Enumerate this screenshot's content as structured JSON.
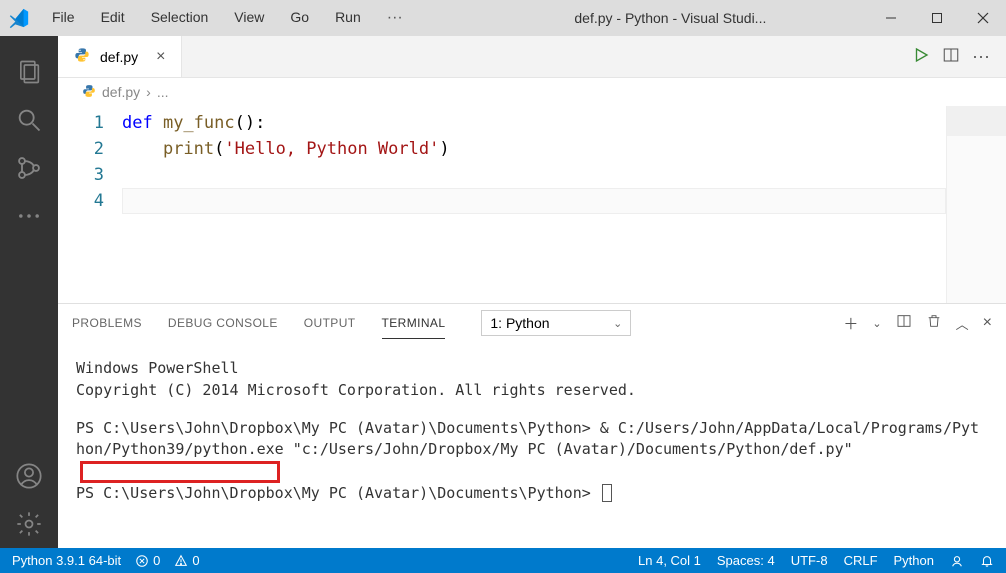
{
  "menu": {
    "file": "File",
    "edit": "Edit",
    "selection": "Selection",
    "view": "View",
    "go": "Go",
    "run": "Run"
  },
  "window_title": "def.py - Python - Visual Studi...",
  "tab": {
    "label": "def.py"
  },
  "breadcrumb": {
    "file": "def.py",
    "sep": "›",
    "rest": "..."
  },
  "code": {
    "line1_kw": "def",
    "line1_fn": " my_func",
    "line1_rest": "():",
    "line2_fn": "print",
    "line2_paren": "(",
    "line2_str": "'Hello, Python World'",
    "line2_close": ")"
  },
  "gutter": {
    "l1": "1",
    "l2": "2",
    "l3": "3",
    "l4": "4"
  },
  "panel": {
    "problems": "PROBLEMS",
    "debug": "DEBUG CONSOLE",
    "output": "OUTPUT",
    "terminal": "TERMINAL",
    "select": "1: Python"
  },
  "terminal": {
    "t1": "Windows PowerShell",
    "t2": "Copyright (C) 2014 Microsoft Corporation. All rights reserved.",
    "t3": "PS C:\\Users\\John\\Dropbox\\My PC (Avatar)\\Documents\\Python> & C:/Users/John/AppData/Local/Programs/Python/Python39/python.exe \"c:/Users/John/Dropbox/My PC (Avatar)/Documents/Python/def.py\"",
    "t4": "PS C:\\Users\\John\\Dropbox\\My PC (Avatar)\\Documents\\Python> "
  },
  "status": {
    "python": "Python 3.9.1 64-bit",
    "err": "0",
    "warn": "0",
    "ln": "Ln 4, Col 1",
    "spaces": "Spaces: 4",
    "enc": "UTF-8",
    "eol": "CRLF",
    "lang": "Python"
  }
}
